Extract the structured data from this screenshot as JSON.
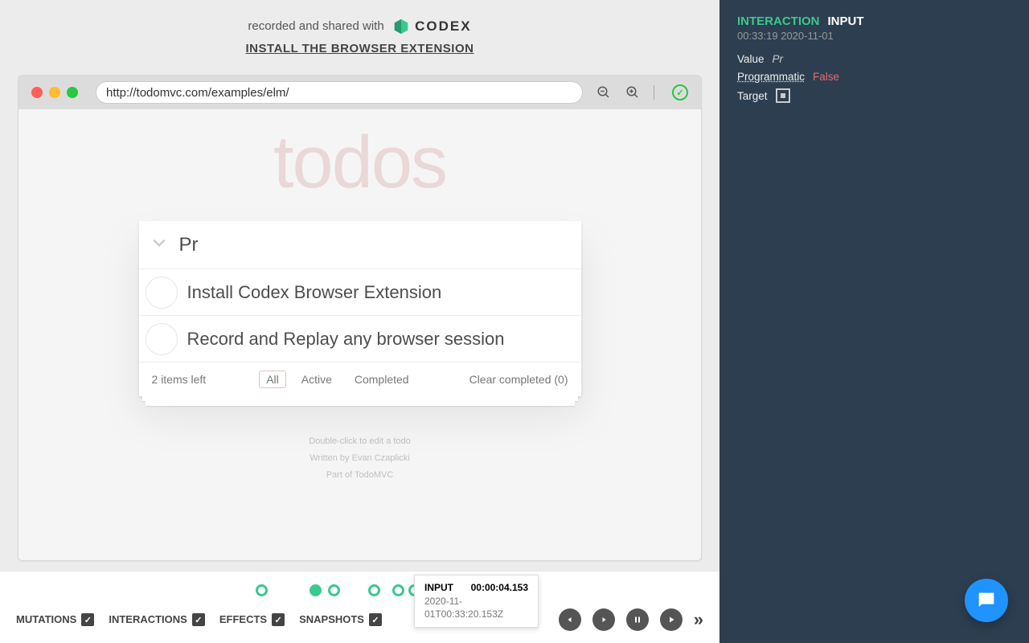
{
  "banner": {
    "recorded": "recorded and shared with",
    "brand": "CODEX",
    "install": "INSTALL THE BROWSER EXTENSION"
  },
  "browser": {
    "url": "http://todomvc.com/examples/elm/"
  },
  "todo": {
    "title": "todos",
    "inputValue": "Pr",
    "items": [
      "Install Codex Browser Extension",
      "Record and Replay any browser session"
    ],
    "count": "2 items left",
    "filters": {
      "all": "All",
      "active": "Active",
      "completed": "Completed"
    },
    "clear": "Clear completed (0)",
    "credits": {
      "line1": "Double-click to edit a todo",
      "line2": "Written by Evan Czaplicki",
      "line3": "Part of TodoMVC"
    }
  },
  "event": {
    "category": "INTERACTION",
    "type": "INPUT",
    "time": "00:33:19 2020-11-01",
    "valueKey": "Value",
    "valueVal": "Pr",
    "progKey": "Programmatic",
    "progVal": "False",
    "targetKey": "Target"
  },
  "timeline": {
    "toggles": {
      "mutations": "MUTATIONS",
      "interactions": "INTERACTIONS",
      "effects": "EFFECTS",
      "snapshots": "SNAPSHOTS"
    },
    "tooltip": {
      "label": "INPUT",
      "elapsed": "00:00:04.153",
      "timestamp": "2020-11-01T00:33:20.153Z"
    }
  }
}
